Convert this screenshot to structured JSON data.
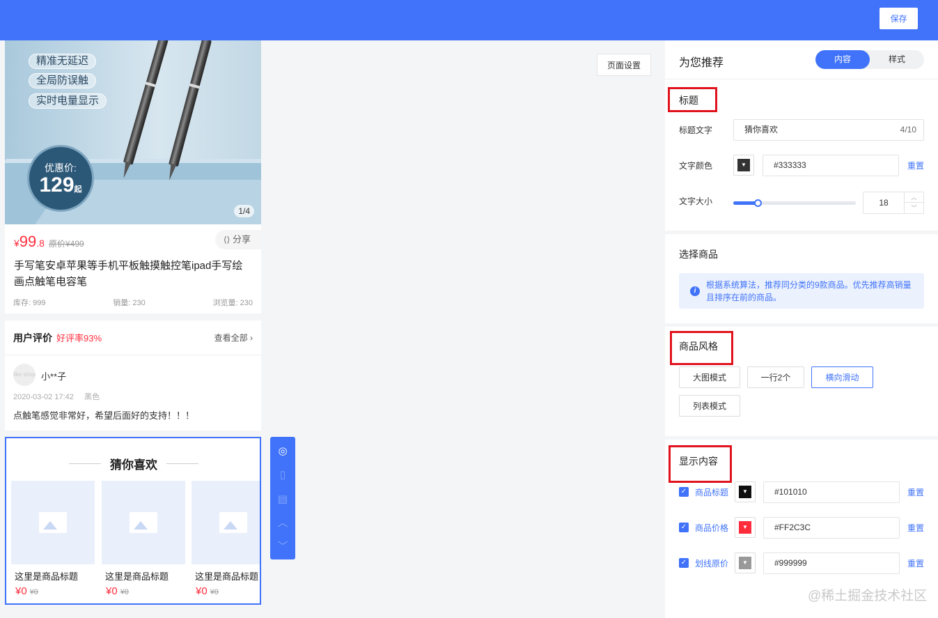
{
  "topbar": {
    "save_label": "保存",
    "color": "#4073fa"
  },
  "hero": {
    "tags": [
      "精准无延迟",
      "全局防误触",
      "实时电量显示"
    ],
    "badge_label": "优惠价:",
    "badge_price": "129",
    "badge_suffix": "起",
    "pager": "1/4"
  },
  "product": {
    "currency": "¥",
    "price_int": "99",
    "price_dec": ".8",
    "original_price": "原价¥499",
    "share_label": "分享",
    "title": "手写笔安卓苹果等手机平板触摸触控笔ipad手写绘画点触笔电容笔",
    "stock": "库存: 999",
    "sales": "销量: 230",
    "views": "浏览量: 230"
  },
  "review": {
    "title": "用户评价",
    "rate": "好评率93%",
    "view_all": "查看全部",
    "avatar_text": "like shop",
    "user": "小**子",
    "date": "2020-03-02 17:42",
    "spec": "黑色",
    "content": "点触笔感觉非常好，希望后面好的支持！！！"
  },
  "guess": {
    "title": "猜你喜欢",
    "items": [
      {
        "name": "这里是商品标题",
        "price": "¥0",
        "orig": "¥0"
      },
      {
        "name": "这里是商品标题",
        "price": "¥0",
        "orig": "¥0"
      },
      {
        "name": "这里是商品标题",
        "price": "¥0",
        "orig": "¥0"
      }
    ]
  },
  "float_toolbar": {
    "icons": [
      "eye-off-icon",
      "trash-icon",
      "copy-icon",
      "chevron-up-icon",
      "chevron-down-icon"
    ]
  },
  "page_settings_label": "页面设置",
  "panel": {
    "title": "为您推荐",
    "tabs": [
      "内容",
      "样式"
    ],
    "title_section": {
      "heading": "标题",
      "text_label": "标题文字",
      "text_value": "猜你喜欢",
      "text_count": "4/10",
      "color_label": "文字颜色",
      "color_value": "#333333",
      "reset": "重置",
      "size_label": "文字大小",
      "size_value": "18",
      "size_fraction": 0.2
    },
    "goods_section": {
      "heading": "选择商品",
      "notice": "根据系统算法，推荐同分类的9款商品。优先推荐高销量且排序在前的商品。"
    },
    "style_section": {
      "heading": "商品风格",
      "options": [
        "大图模式",
        "一行2个",
        "横向滑动",
        "列表模式"
      ],
      "selected": "横向滑动"
    },
    "display_section": {
      "heading": "显示内容",
      "rows": [
        {
          "label": "商品标题",
          "color": "#101010",
          "reset": "重置"
        },
        {
          "label": "商品价格",
          "color": "#FF2C3C",
          "reset": "重置"
        },
        {
          "label": "划线原价",
          "color": "#999999",
          "reset": "重置"
        }
      ]
    }
  },
  "watermark": "@稀土掘金技术社区"
}
